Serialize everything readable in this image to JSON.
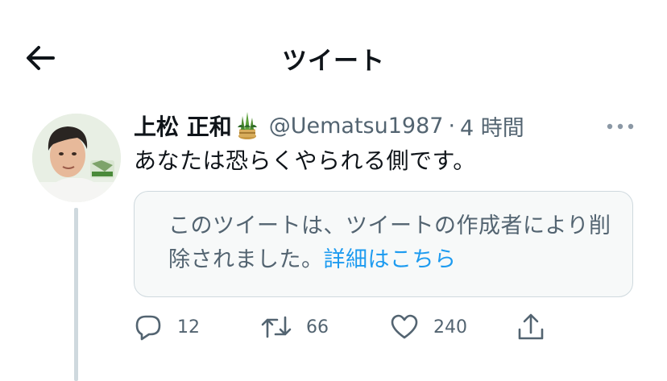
{
  "header": {
    "title": "ツイート",
    "back_icon": "arrow-left-icon"
  },
  "tweet": {
    "display_name": "上松 正和",
    "name_emoji": "kadomatsu-emoji",
    "handle": "@Uematsu1987",
    "separator": "·",
    "time": "4 時間",
    "text": "あなたは恐らくやられる側です。",
    "quote": {
      "message": "このツイートは、ツイートの作成者により削除されました。",
      "learn_more": "詳細はこちら"
    },
    "actions": {
      "reply_count": "12",
      "retweet_count": "66",
      "like_count": "240"
    }
  },
  "colors": {
    "text_primary": "#0f1419",
    "text_secondary": "#536471",
    "link": "#1d9bf0",
    "border": "#cfd9de",
    "card_bg": "#f7f9f9"
  }
}
